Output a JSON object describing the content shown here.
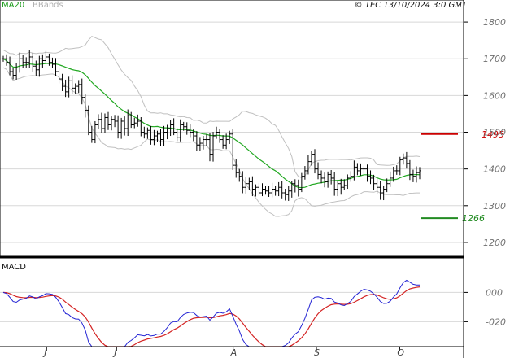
{
  "header": {
    "copyright": "© TEC 13/10/2024 3:0 GMT",
    "legend_ma": "MA20",
    "legend_bb": "BBands"
  },
  "colors": {
    "price": "#000000",
    "ma": "#22a822",
    "bands": "#c0c0c0",
    "grid": "#d8d8d8",
    "resistance": "#cc0000",
    "support": "#228b22",
    "macd": "#2424d4",
    "signal": "#d42424",
    "axis": "#000000"
  },
  "chart_data": [
    {
      "type": "ohlc",
      "name": "price",
      "ylim": [
        1160,
        1860
      ],
      "yticks": [
        1200,
        1300,
        1400,
        1500,
        1600,
        1700,
        1800
      ],
      "ytick_labels": [
        "1200",
        "1300",
        "1400",
        "1500",
        "1600",
        "1700",
        "1800"
      ],
      "xtick_labels": [
        "J",
        "J",
        "A",
        "S",
        "O"
      ],
      "xtick_positions": [
        13,
        34,
        69,
        94,
        119
      ],
      "bars_count": 130,
      "close": [
        1700,
        1690,
        1665,
        1655,
        1675,
        1700,
        1690,
        1690,
        1705,
        1680,
        1670,
        1700,
        1695,
        1705,
        1690,
        1685,
        1665,
        1645,
        1625,
        1610,
        1640,
        1620,
        1625,
        1630,
        1595,
        1560,
        1500,
        1480,
        1520,
        1535,
        1510,
        1540,
        1520,
        1535,
        1530,
        1500,
        1530,
        1510,
        1545,
        1520,
        1525,
        1530,
        1500,
        1495,
        1505,
        1480,
        1490,
        1495,
        1480,
        1500,
        1510,
        1520,
        1500,
        1485,
        1520,
        1515,
        1505,
        1500,
        1490,
        1465,
        1470,
        1480,
        1480,
        1440,
        1490,
        1500,
        1480,
        1465,
        1480,
        1495,
        1410,
        1390,
        1380,
        1350,
        1360,
        1365,
        1345,
        1350,
        1335,
        1345,
        1340,
        1335,
        1345,
        1340,
        1350,
        1335,
        1330,
        1340,
        1360,
        1355,
        1345,
        1380,
        1395,
        1420,
        1440,
        1400,
        1385,
        1375,
        1365,
        1385,
        1375,
        1345,
        1360,
        1350,
        1355,
        1375,
        1380,
        1405,
        1395,
        1400,
        1400,
        1380,
        1375,
        1360,
        1350,
        1335,
        1345,
        1360,
        1375,
        1395,
        1395,
        1425,
        1430,
        1415,
        1385,
        1380,
        1390,
        1395
      ],
      "resistance": {
        "value": 1495,
        "label": "1495"
      },
      "support": {
        "value": 1266,
        "label": "1266"
      }
    },
    {
      "type": "line",
      "name": "MACD",
      "title": "MACD",
      "ylim": [
        -37,
        23
      ],
      "yticks": [
        0,
        -20
      ],
      "ytick_labels": [
        "000",
        "-020"
      ]
    }
  ]
}
